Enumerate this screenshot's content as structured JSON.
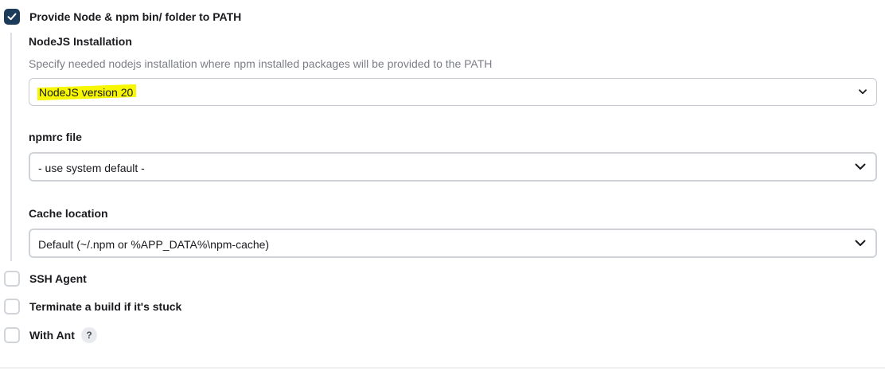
{
  "nodejs_section": {
    "checkbox_label": "Provide Node & npm bin/ folder to PATH",
    "checked": true,
    "installation": {
      "label": "NodeJS Installation",
      "description": "Specify needed nodejs installation where npm installed packages will be provided to the PATH",
      "selected": "NodeJS version 20",
      "highlight_color": "#f6f700"
    },
    "npmrc": {
      "label": "npmrc file",
      "selected": "- use system default -"
    },
    "cache": {
      "label": "Cache location",
      "selected": "Default (~/.npm or %APP_DATA%\\npm-cache)"
    }
  },
  "options": [
    {
      "label": "SSH Agent",
      "checked": false
    },
    {
      "label": "Terminate a build if it's stuck",
      "checked": false
    },
    {
      "label": "With Ant",
      "checked": false,
      "help": "?"
    }
  ],
  "colors": {
    "checkbox_checked": "#1c3a5a",
    "text": "#1b1b1f",
    "muted_text": "#7b7e85"
  }
}
